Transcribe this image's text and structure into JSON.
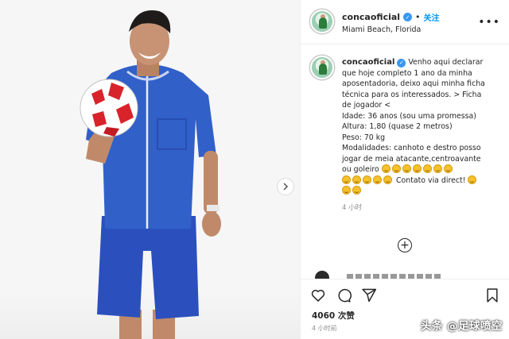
{
  "post": {
    "username": "concaoficial",
    "follow_separator": "•",
    "follow_label": "关注",
    "location": "Miami Beach, Florida"
  },
  "caption": {
    "username": "concaoficial",
    "lines": [
      "Venho aqui declarar",
      "que hoje completo 1 ano da minha",
      "aposentadoria, deixo aqui minha ficha",
      "técnica para os interessados. > Ficha",
      "de jogador <",
      "Idade: 36 anos (sou uma promessa)",
      "Altura: 1,80 (quase 2 metros)",
      "Peso: 70 kg",
      "Modalidades: canhoto e destro posso",
      "jogar de meia atacante,centroavante",
      "ou goleiro"
    ],
    "contact_text": "Contato via direct!",
    "timestamp": "4 小时"
  },
  "icons": {
    "verified": "verified-badge-icon",
    "more": "more-options-icon",
    "next": "chevron-right-icon",
    "load_more": "plus-circle-icon",
    "like": "heart-icon",
    "comment": "comment-icon",
    "share": "share-icon",
    "save": "bookmark-icon"
  },
  "footer": {
    "likes": "4060 次赞",
    "time": "4 小时前"
  },
  "watermark": "头条 @足球喷空",
  "colors": {
    "accent": "#0095f6",
    "verified": "#3897f0",
    "jersey": "#2f56c4",
    "ball_red": "#d8232a"
  }
}
